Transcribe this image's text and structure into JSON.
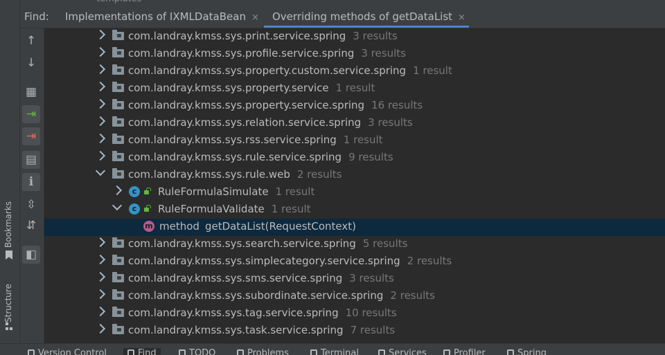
{
  "top_fragment": "templates",
  "find": {
    "label": "Find:",
    "tabs": [
      {
        "label": "Implementations of IXMLDataBean",
        "close": "×",
        "active": false
      },
      {
        "label": "Overriding methods of getDataList",
        "close": "×",
        "active": true
      }
    ]
  },
  "toolbar": {
    "buttons": [
      {
        "name": "previous-occurrence-button",
        "icon": "up-arrow-icon",
        "glyph": "↑"
      },
      {
        "name": "next-occurrence-button",
        "icon": "down-arrow-icon",
        "glyph": "↓"
      },
      {
        "name": "group-by-button",
        "icon": "group-icon",
        "glyph": "▦"
      },
      {
        "name": "navigate-in-button",
        "icon": "arrow-right-green-icon",
        "glyph": "⇥"
      },
      {
        "name": "navigate-out-button",
        "icon": "arrow-right-red-icon",
        "glyph": "⇥"
      },
      {
        "name": "group-by-directory-button",
        "icon": "folder-settings-icon",
        "glyph": "▤"
      },
      {
        "name": "info-button",
        "icon": "info-icon",
        "glyph": "i"
      },
      {
        "name": "expand-all-button",
        "icon": "expand-all-icon",
        "glyph": "⇳"
      },
      {
        "name": "collapse-all-button",
        "icon": "collapse-all-icon",
        "glyph": "⇵"
      },
      {
        "name": "preview-button",
        "icon": "preview-icon",
        "glyph": "◧"
      }
    ]
  },
  "tree": {
    "rows": [
      {
        "kind": "package",
        "label": "com.landray.kmss.sys.print.service.spring",
        "count": "3 results"
      },
      {
        "kind": "package",
        "label": "com.landray.kmss.sys.profile.service.spring",
        "count": "3 results"
      },
      {
        "kind": "package",
        "label": "com.landray.kmss.sys.property.custom.service.spring",
        "count": "1 result"
      },
      {
        "kind": "package",
        "label": "com.landray.kmss.sys.property.service",
        "count": "1 result"
      },
      {
        "kind": "package",
        "label": "com.landray.kmss.sys.property.service.spring",
        "count": "16 results"
      },
      {
        "kind": "package",
        "label": "com.landray.kmss.sys.relation.service.spring",
        "count": "3 results"
      },
      {
        "kind": "package",
        "label": "com.landray.kmss.sys.rss.service.spring",
        "count": "1 result"
      },
      {
        "kind": "package",
        "label": "com.landray.kmss.sys.rule.service.spring",
        "count": "9 results"
      },
      {
        "kind": "package-open",
        "label": "com.landray.kmss.sys.rule.web",
        "count": "2 results"
      },
      {
        "kind": "class",
        "label": "RuleFormulaSimulate",
        "count": "1 result"
      },
      {
        "kind": "class-open",
        "label": "RuleFormulaValidate",
        "count": "1 result"
      },
      {
        "kind": "method",
        "keyword": "method",
        "label": "getDataList(RequestContext)",
        "count": ""
      },
      {
        "kind": "package",
        "label": "com.landray.kmss.sys.search.service.spring",
        "count": "5 results"
      },
      {
        "kind": "package",
        "label": "com.landray.kmss.sys.simplecategory.service.spring",
        "count": "2 results"
      },
      {
        "kind": "package",
        "label": "com.landray.kmss.sys.sms.service.spring",
        "count": "3 results"
      },
      {
        "kind": "package",
        "label": "com.landray.kmss.sys.subordinate.service.spring",
        "count": "2 results"
      },
      {
        "kind": "package",
        "label": "com.landray.kmss.sys.tag.service.spring",
        "count": "10 results"
      },
      {
        "kind": "package",
        "label": "com.landray.kmss.sys.task.service.spring",
        "count": "7 results"
      }
    ]
  },
  "side": {
    "bookmarks": "Bookmarks",
    "structure": "Structure"
  },
  "bottom_tabs": [
    {
      "label": "Version Control",
      "active": false
    },
    {
      "label": "Find",
      "active": true
    },
    {
      "label": "TODO",
      "active": false
    },
    {
      "label": "Problems",
      "active": false
    },
    {
      "label": "Terminal",
      "active": false
    },
    {
      "label": "Services",
      "active": false
    },
    {
      "label": "Profiler",
      "active": false
    },
    {
      "label": "Spring",
      "active": false
    }
  ],
  "colors": {
    "background": "#2b2b2b",
    "panel": "#3c3f41",
    "selection": "#0d293e",
    "accent": "#4a88c7",
    "count_text": "#787878"
  }
}
